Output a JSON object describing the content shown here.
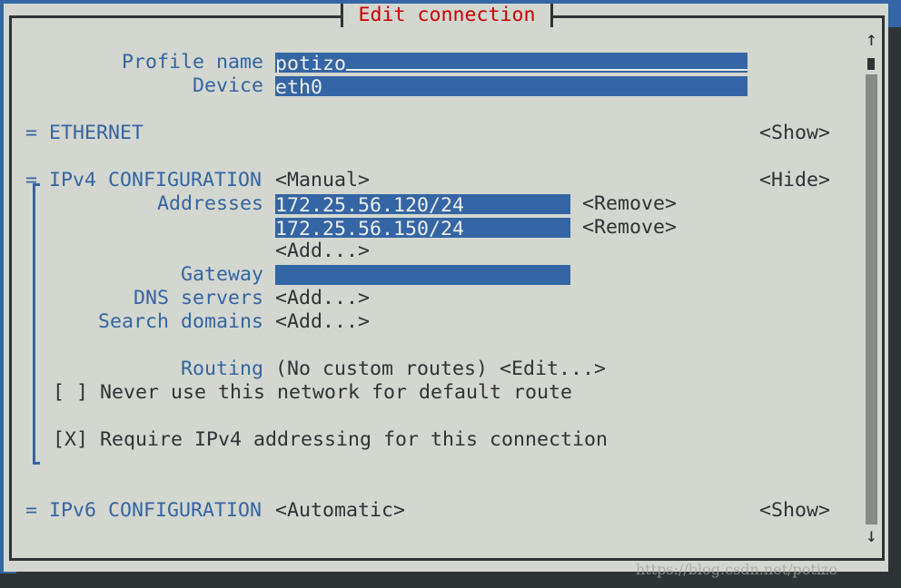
{
  "title": "Edit connection",
  "profile": {
    "label": "Profile name",
    "value": "potizo"
  },
  "device": {
    "label": "Device",
    "value": "eth0"
  },
  "ethernet": {
    "label": "= ETHERNET",
    "toggle": "<Show>"
  },
  "ipv4": {
    "label": "= IPv4 CONFIGURATION",
    "mode": "<Manual>",
    "toggle": "<Hide>",
    "addresses_label": "Addresses",
    "addresses": [
      "172.25.56.120/24",
      "172.25.56.150/24"
    ],
    "remove": "<Remove>",
    "add": "<Add...>",
    "gateway_label": "Gateway",
    "gateway": "",
    "dns_label": "DNS servers",
    "dns_add": "<Add...>",
    "search_label": "Search domains",
    "search_add": "<Add...>",
    "routing_label": "Routing",
    "routing_value": "(No custom routes)",
    "routing_edit": "<Edit...>",
    "never_default": "[ ] Never use this network for default route",
    "require_ipv4": "[X] Require IPv4 addressing for this connection"
  },
  "ipv6": {
    "label": "= IPv6 CONFIGURATION",
    "mode": "<Automatic>",
    "toggle": "<Show>"
  },
  "scroll": {
    "up": "↑",
    "down": "↓"
  },
  "watermark": "https://blog.csdn.net/potizo"
}
